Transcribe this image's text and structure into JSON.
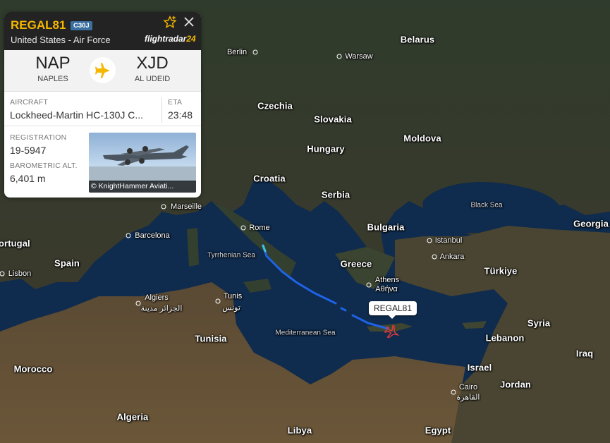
{
  "flight": {
    "callsign": "REGAL81",
    "aircraft_type": "C30J",
    "airline": "United States - Air Force",
    "brand_name": "flightradar",
    "brand_suffix": "24",
    "origin": {
      "code": "NAP",
      "city": "NAPLES"
    },
    "destination": {
      "code": "XJD",
      "city": "AL UDEID"
    },
    "aircraft_label": "AIRCRAFT",
    "aircraft_value": "Lockheed-Martin HC-130J C...",
    "eta_label": "ETA",
    "eta_value": "23:48",
    "registration_label": "REGISTRATION",
    "registration_value": "19-5947",
    "altitude_label": "BAROMETRIC ALT.",
    "altitude_value": "6,401 m",
    "photo_credit": "© KnightHammer Aviati...",
    "map_tag": "REGAL81"
  },
  "map": {
    "countries": [
      "Belarus",
      "Czechia",
      "Slovakia",
      "Moldova",
      "Hungary",
      "Croatia",
      "Serbia",
      "Bulgaria",
      "Georgia",
      "Portugal",
      "Spain",
      "Greece",
      "Türkiye",
      "Syria",
      "Lebanon",
      "Iraq",
      "Tunisia",
      "Morocco",
      "Israel",
      "Jordan",
      "Algeria",
      "Libya",
      "Egypt"
    ],
    "cities": [
      "Berlin",
      "Warsaw",
      "Marseille",
      "Rome",
      "Barcelona",
      "Lisbon",
      "Istanbul",
      "Ankara",
      "Athens",
      "Αθήνα",
      "Algiers",
      "الجزائر مدينة",
      "Tunis",
      "تونس",
      "Cairo",
      "القاهرة"
    ],
    "seas": [
      "Black Sea",
      "Tyrrhenian Sea",
      "Mediterranean Sea"
    ],
    "colors": {
      "track": "#1e63e6",
      "callsign": "#f5b700",
      "badge": "#3b6fa0"
    }
  }
}
